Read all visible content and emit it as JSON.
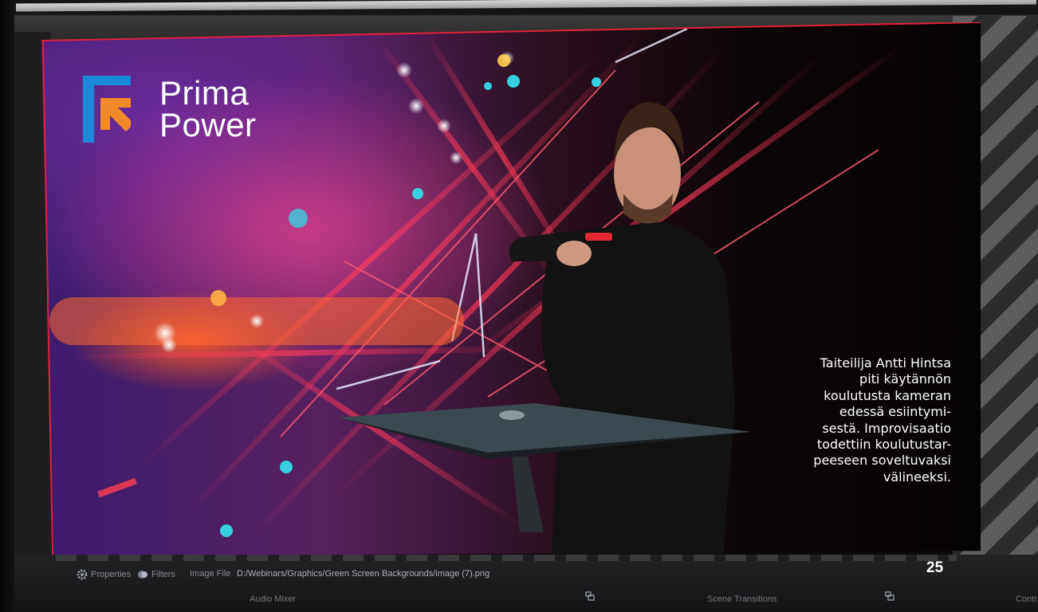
{
  "brand": {
    "line1": "Prima",
    "line2": "Power",
    "colors": {
      "blue": "#1a8ad8",
      "orange": "#f08a2a"
    }
  },
  "caption": {
    "lines": [
      "Taiteilija Antti Hintsa",
      "piti käytännön",
      "koulutusta kameran",
      "edessä esiintymi-",
      "sestä. Improvisaatio",
      "todettiin koulutustar-",
      "peeseen soveltuvaksi",
      "välineeksi."
    ]
  },
  "page_number": "25",
  "toolbar": {
    "properties_label": "Properties",
    "filters_label": "Filters",
    "image_file_label": "Image File",
    "file_path": "D:/Webinars/Graphics/Green Screen Backgrounds/image (7).png",
    "properties_icon": "gear-icon",
    "filters_icon": "filter-icon"
  },
  "docks": {
    "audio_mixer": "Audio Mixer",
    "scene_transitions": "Scene Transitions",
    "controls": "Contr",
    "undock_icon": "undock-icon"
  },
  "colors": {
    "selection_outline": "#e0203a",
    "accent_red": "#ff2e4e"
  }
}
